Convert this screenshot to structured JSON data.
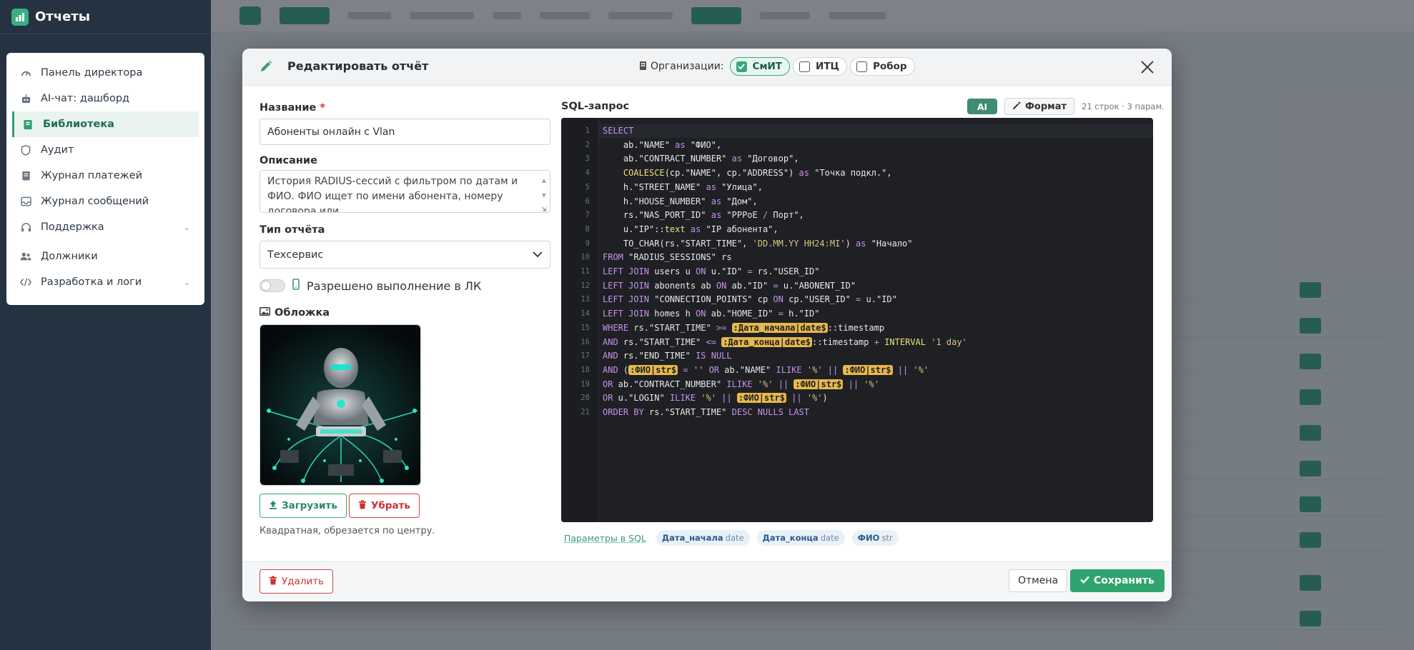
{
  "app": {
    "title": "Отчеты"
  },
  "sidebar": {
    "items": [
      {
        "label": "Панель директора",
        "icon": "gauge-icon"
      },
      {
        "label": "AI-чат: дашборд",
        "icon": "robot-icon"
      },
      {
        "label": "Библиотека",
        "icon": "book-icon",
        "active": true
      },
      {
        "label": "Аудит",
        "icon": "shield-icon"
      },
      {
        "label": "Журнал платежей",
        "icon": "receipt-icon"
      },
      {
        "label": "Журнал сообщений",
        "icon": "inbox-icon"
      },
      {
        "label": "Поддержка",
        "icon": "headset-icon",
        "expandable": true
      },
      {
        "label": "Должники",
        "icon": "users-icon"
      },
      {
        "label": "Разработка и логи",
        "icon": "code-icon",
        "expandable": true
      }
    ]
  },
  "modal": {
    "title": "Редактировать отчёт",
    "orgs_label": "Организации:",
    "orgs": [
      {
        "label": "СмИТ",
        "checked": true
      },
      {
        "label": "ИТЦ",
        "checked": false
      },
      {
        "label": "Робор",
        "checked": false
      }
    ],
    "form": {
      "name_label": "Название",
      "name_required": "*",
      "name_value": "Абоненты онлайн с Vlan",
      "desc_label": "Описание",
      "desc_value": "История RADIUS-сессий с фильтром по датам и ФИО. ФИО ищет по имени абонента, номеру договора или",
      "type_label": "Тип отчёта",
      "type_value": "Техсервис",
      "lk_toggle_label": "Разрешено выполнение в ЛК",
      "cover_label": "Обложка",
      "upload_label": "Загрузить",
      "remove_label": "Убрать",
      "cover_hint": "Квадратная, обрезается по центру."
    },
    "sql": {
      "label": "SQL-запрос",
      "ai_label": "AI",
      "format_label": "Формат",
      "meta": "21 строк · 3 парам.",
      "lines": [
        "1",
        "2",
        "3",
        "4",
        "5",
        "6",
        "7",
        "8",
        "9",
        "10",
        "11",
        "12",
        "13",
        "14",
        "15",
        "16",
        "17",
        "18",
        "19",
        "20",
        "21"
      ],
      "params_label": "Параметры в SQL",
      "params": [
        {
          "name": "Дата_начала",
          "type": "date"
        },
        {
          "name": "Дата_конца",
          "type": "date"
        },
        {
          "name": "ФИО",
          "type": "str"
        }
      ]
    },
    "footer": {
      "delete_label": "Удалить",
      "cancel_label": "Отмена",
      "save_label": "Сохранить"
    }
  },
  "colors": {
    "accent": "#3cae84",
    "danger": "#d24545",
    "editor_bg": "#1e2024",
    "param_highlight": "#e7b84a"
  }
}
